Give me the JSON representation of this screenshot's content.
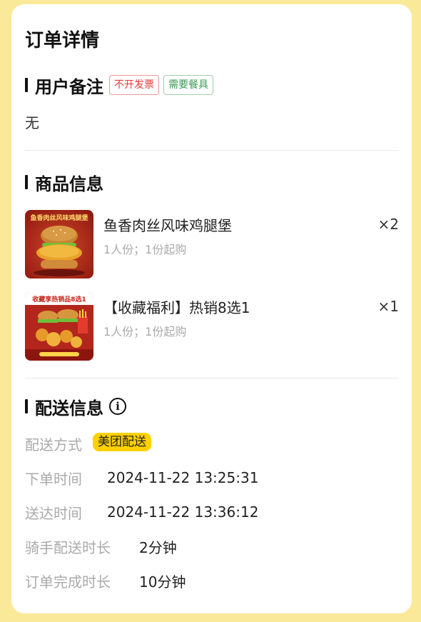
{
  "title": "订单详情",
  "remark_section": {
    "title": "用户备注",
    "tags": [
      {
        "label": "不开发票",
        "color": "#e53935"
      },
      {
        "label": "需要餐具",
        "color": "#3c9b55"
      }
    ],
    "content": "无"
  },
  "product_section": {
    "title": "商品信息",
    "items": [
      {
        "name": "鱼香肉丝风味鸡腿堡",
        "desc": "1人份；1份起购",
        "qty": "×2",
        "image_text": "鱼香肉丝风味鸡腿堡"
      },
      {
        "name": "【收藏福利】热销8选1",
        "desc": "1人份；1份起购",
        "qty": "×1",
        "image_text": "收藏享热销品8选1"
      }
    ]
  },
  "delivery_section": {
    "title": "配送信息",
    "info_icon": "info-circle-icon",
    "rows": [
      {
        "label": "配送方式",
        "value": "美团配送"
      },
      {
        "label": "下单时间",
        "value": "2024-11-22 13:25:31"
      },
      {
        "label": "送达时间",
        "value": "2024-11-22 13:36:12"
      },
      {
        "label": "骑手配送时长",
        "value": "2分钟"
      },
      {
        "label": "订单完成时长",
        "value": "10分钟"
      }
    ]
  },
  "colors": {
    "background": "#fbe99a",
    "badge": "#ffd100",
    "label_gray": "#aaaaaa"
  }
}
